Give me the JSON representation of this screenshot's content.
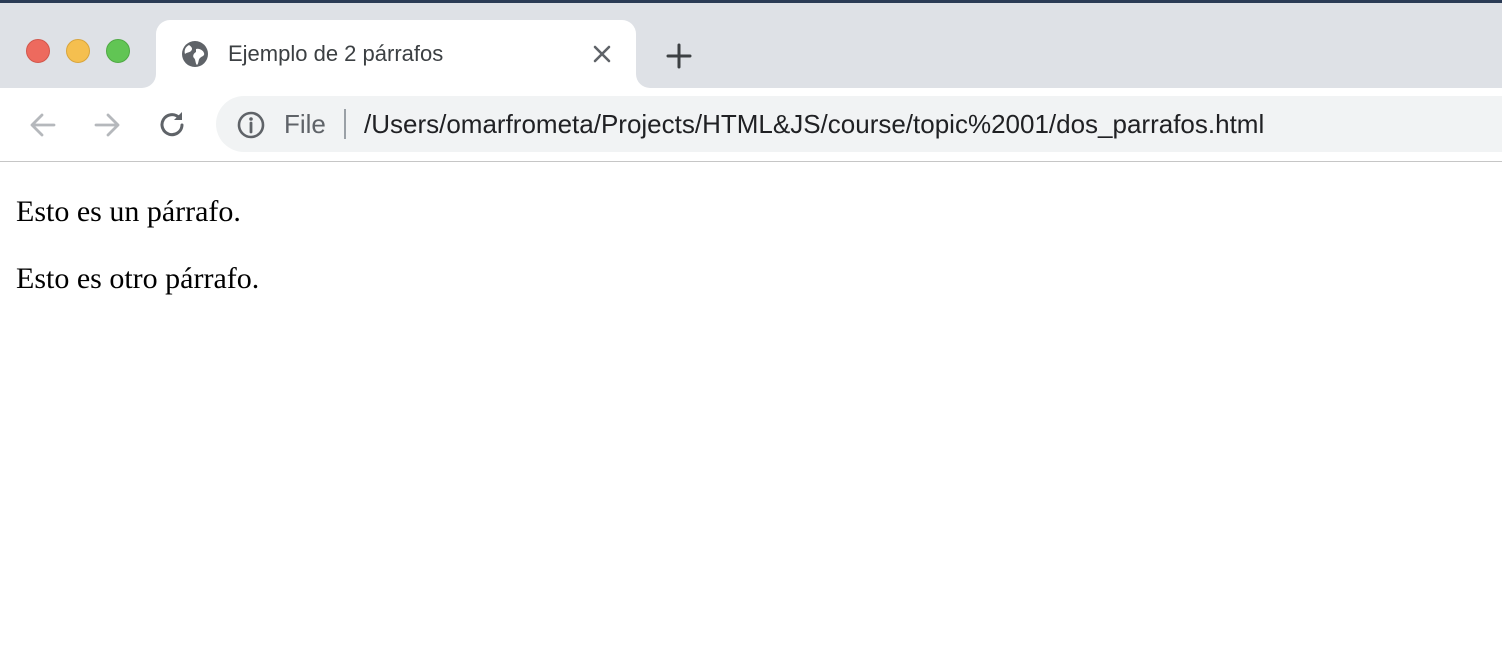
{
  "browser": {
    "tab": {
      "title": "Ejemplo de 2 párrafos",
      "favicon": "globe-icon",
      "close_icon": "close-icon"
    },
    "new_tab_icon": "plus-icon",
    "toolbar": {
      "back_icon": "arrow-left-icon",
      "forward_icon": "arrow-right-icon",
      "reload_icon": "reload-icon"
    },
    "omnibox": {
      "security_icon": "info-icon",
      "scheme_label": "File",
      "url": "/Users/omarfrometa/Projects/HTML&JS/course/topic%2001/dos_parrafos.html"
    }
  },
  "page": {
    "paragraphs": [
      "Esto es un párrafo.",
      "Esto es otro párrafo."
    ]
  },
  "colors": {
    "tabstrip_bg": "#dee1e6",
    "omnibox_bg": "#f1f3f4",
    "traffic_close": "#ed6a5e",
    "traffic_minimize": "#f5bf4f",
    "traffic_zoom": "#61c554"
  }
}
